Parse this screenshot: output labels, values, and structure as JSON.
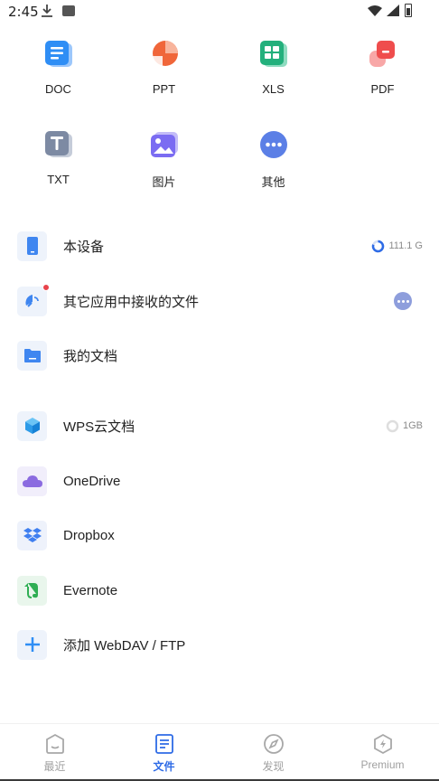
{
  "status_bar": {
    "time": "2:45"
  },
  "file_types": [
    {
      "label": "DOC",
      "icon": "doc-icon"
    },
    {
      "label": "PPT",
      "icon": "ppt-icon"
    },
    {
      "label": "XLS",
      "icon": "xls-icon"
    },
    {
      "label": "PDF",
      "icon": "pdf-icon"
    },
    {
      "label": "TXT",
      "icon": "txt-icon"
    },
    {
      "label": "图片",
      "icon": "image-icon"
    },
    {
      "label": "其他",
      "icon": "more-icon"
    }
  ],
  "locations": [
    {
      "label": "本设备",
      "meta": "111.1 G",
      "icon": "phone-icon"
    },
    {
      "label": "其它应用中接收的文件",
      "icon": "satellite-icon"
    },
    {
      "label": "我的文档",
      "icon": "folder-icon"
    }
  ],
  "cloud": [
    {
      "label": "WPS云文档",
      "meta": "1GB",
      "icon": "cube-icon"
    },
    {
      "label": "OneDrive",
      "icon": "onedrive-icon"
    },
    {
      "label": "Dropbox",
      "icon": "dropbox-icon"
    },
    {
      "label": "Evernote",
      "icon": "evernote-icon"
    },
    {
      "label": "添加 WebDAV / FTP",
      "icon": "plus-icon"
    }
  ],
  "bottom_nav": [
    {
      "label": "最近",
      "active": false
    },
    {
      "label": "文件",
      "active": true
    },
    {
      "label": "发现",
      "active": false
    },
    {
      "label": "Premium",
      "active": false
    }
  ],
  "colors": {
    "accent": "#2e6be6",
    "doc": "#2f8ef5",
    "ppt": "#f0663a",
    "xls": "#23b07c",
    "pdf": "#ef4d4d",
    "txt": "#7d8aa3",
    "image": "#7b6cf2",
    "other": "#5b7fe6"
  }
}
